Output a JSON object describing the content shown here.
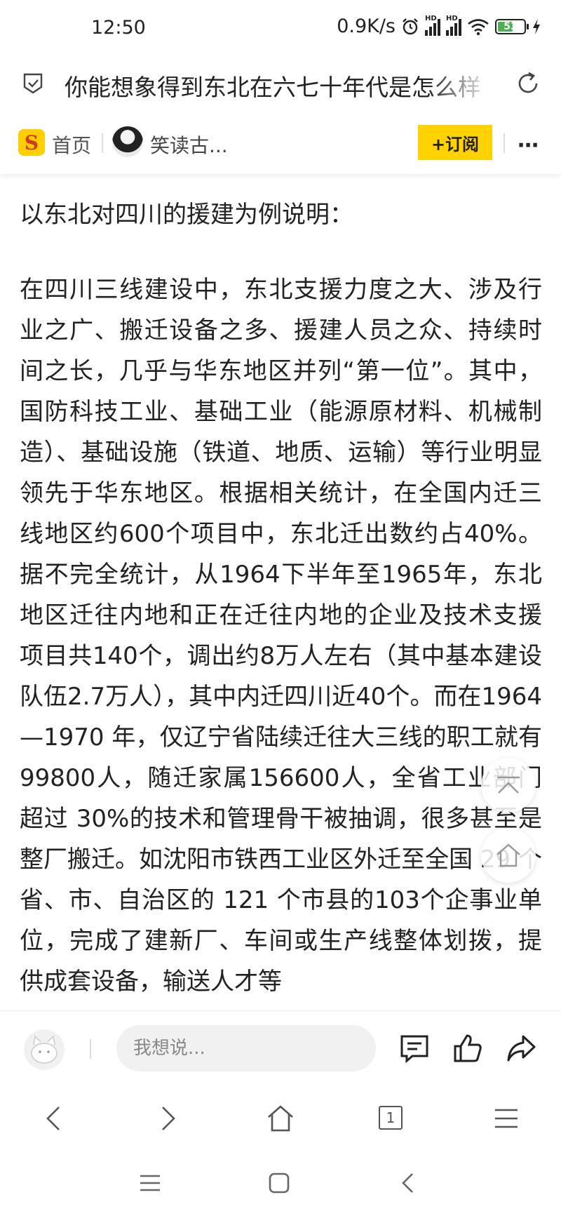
{
  "status_bar": {
    "time": "12:50",
    "network_speed": "0.9K/s",
    "signal_badge_1": "HD",
    "signal_badge_2": "HD",
    "battery": "53"
  },
  "title_bar": {
    "title": "你能想象得到东北在六七十年代是怎么样"
  },
  "nav_bar": {
    "home_label": "首页",
    "author_name": "笑读古...",
    "subscribe_label": "+订阅",
    "more_label": "⋯"
  },
  "article": {
    "lead": "以东北对四川的援建为例说明：",
    "body": "在四川三线建设中，东北支援力度之大、涉及行业之广、搬迁设备之多、援建人员之众、持续时间之长，几乎与华东地区并列“第一位”。其中，国防科技工业、基础工业（能源原材料、机械制造）、基础设施（铁道、地质、运输）等行业明显领先于华东地区。根据相关统计，在全国内迁三线地区约600个项目中，东北迁出数约占40%。据不完全统计，从1964下半年至1965年，东北地区迁往内地和正在迁往内地的企业及技术支援项目共140个，调出约8万人左右（其中基本建设队伍2.7万人），其中内迁四川近40个。而在1964—1970 年，仅辽宁省陆续迁往大三线的职工就有99800人，随迁家属156600人，全省工业部门超过 30%的技术和管理骨干被抽调，很多甚至是整厂搬迁。如沈阳市铁西工业区外迁至全国 29 个省、市、自治区的 121 个市县的103个企事业单位，完成了建新厂、车间或生产线整体划拨，提供成套设备，输送人才等"
  },
  "comment_bar": {
    "placeholder": "我想说..."
  },
  "browser_bar": {
    "tab_count": "1"
  },
  "colors": {
    "accent_yellow": "#FFD200",
    "logo_red": "#D4381E",
    "battery_green": "#4CAF50"
  }
}
